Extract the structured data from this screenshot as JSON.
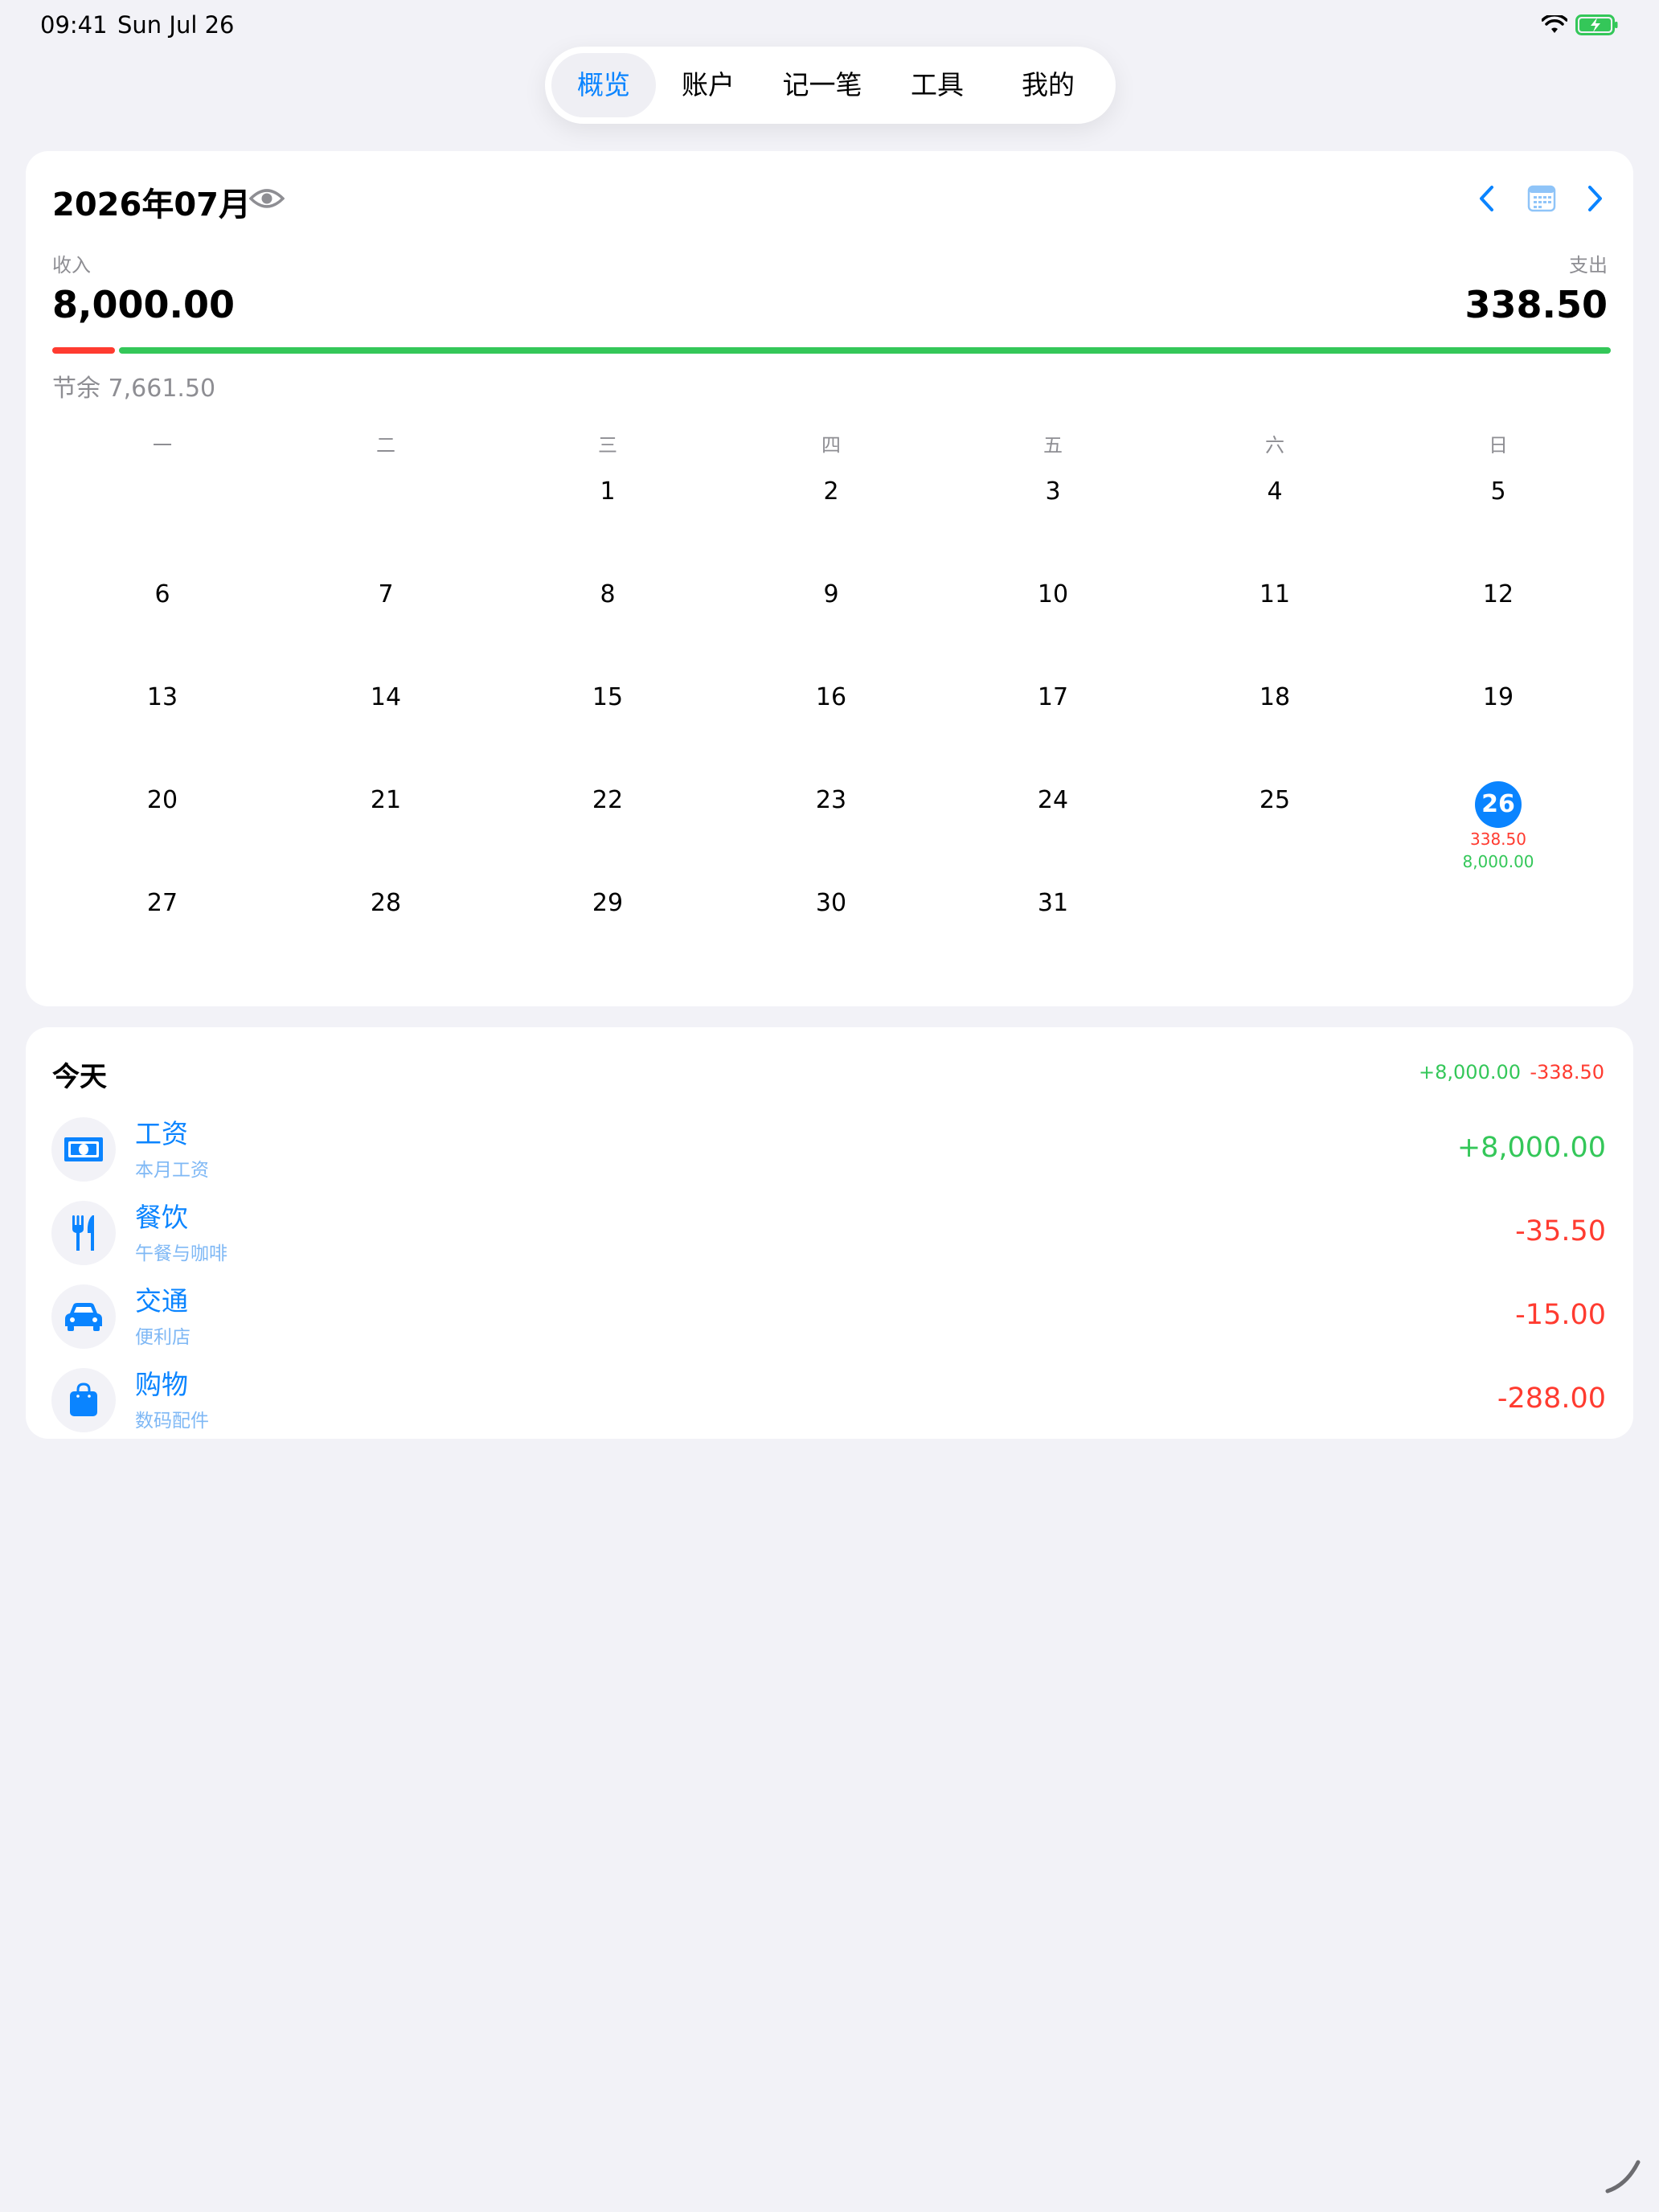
{
  "status": {
    "time": "09:41",
    "date": "Sun Jul 26"
  },
  "tabs": [
    {
      "label": "概览"
    },
    {
      "label": "账户"
    },
    {
      "label": "记一笔"
    },
    {
      "label": "工具"
    },
    {
      "label": "我的"
    }
  ],
  "summary": {
    "month": "2026年07月",
    "income_label": "收入",
    "income": "8,000.00",
    "expense_label": "支出",
    "expense": "338.50",
    "surplus": "节余 7,661.50"
  },
  "calendar": {
    "weekdays": [
      "一",
      "二",
      "三",
      "四",
      "五",
      "六",
      "日"
    ],
    "days": [
      "1",
      "2",
      "3",
      "4",
      "5",
      "6",
      "7",
      "8",
      "9",
      "10",
      "11",
      "12",
      "13",
      "14",
      "15",
      "16",
      "17",
      "18",
      "19",
      "20",
      "21",
      "22",
      "23",
      "24",
      "25",
      "26",
      "27",
      "28",
      "29",
      "30",
      "31"
    ],
    "today": {
      "day": "26",
      "expense": "338.50",
      "income": "8,000.00"
    }
  },
  "today_list": {
    "title": "今天",
    "income_total": "+8,000.00",
    "expense_total": "-338.50",
    "items": [
      {
        "title": "工资",
        "subtitle": "本月工资",
        "amount": "+8,000.00",
        "icon": "money-icon"
      },
      {
        "title": "餐饮",
        "subtitle": "午餐与咖啡",
        "amount": "-35.50",
        "icon": "fork-knife-icon"
      },
      {
        "title": "交通",
        "subtitle": "便利店",
        "amount": "-15.00",
        "icon": "car-icon"
      },
      {
        "title": "购物",
        "subtitle": "数码配件",
        "amount": "-288.00",
        "icon": "shopping-bag-icon"
      }
    ]
  },
  "colors": {
    "accent": "#0A84FF",
    "income": "#34C759",
    "expense": "#FF3B30",
    "background": "#F2F2F7"
  }
}
